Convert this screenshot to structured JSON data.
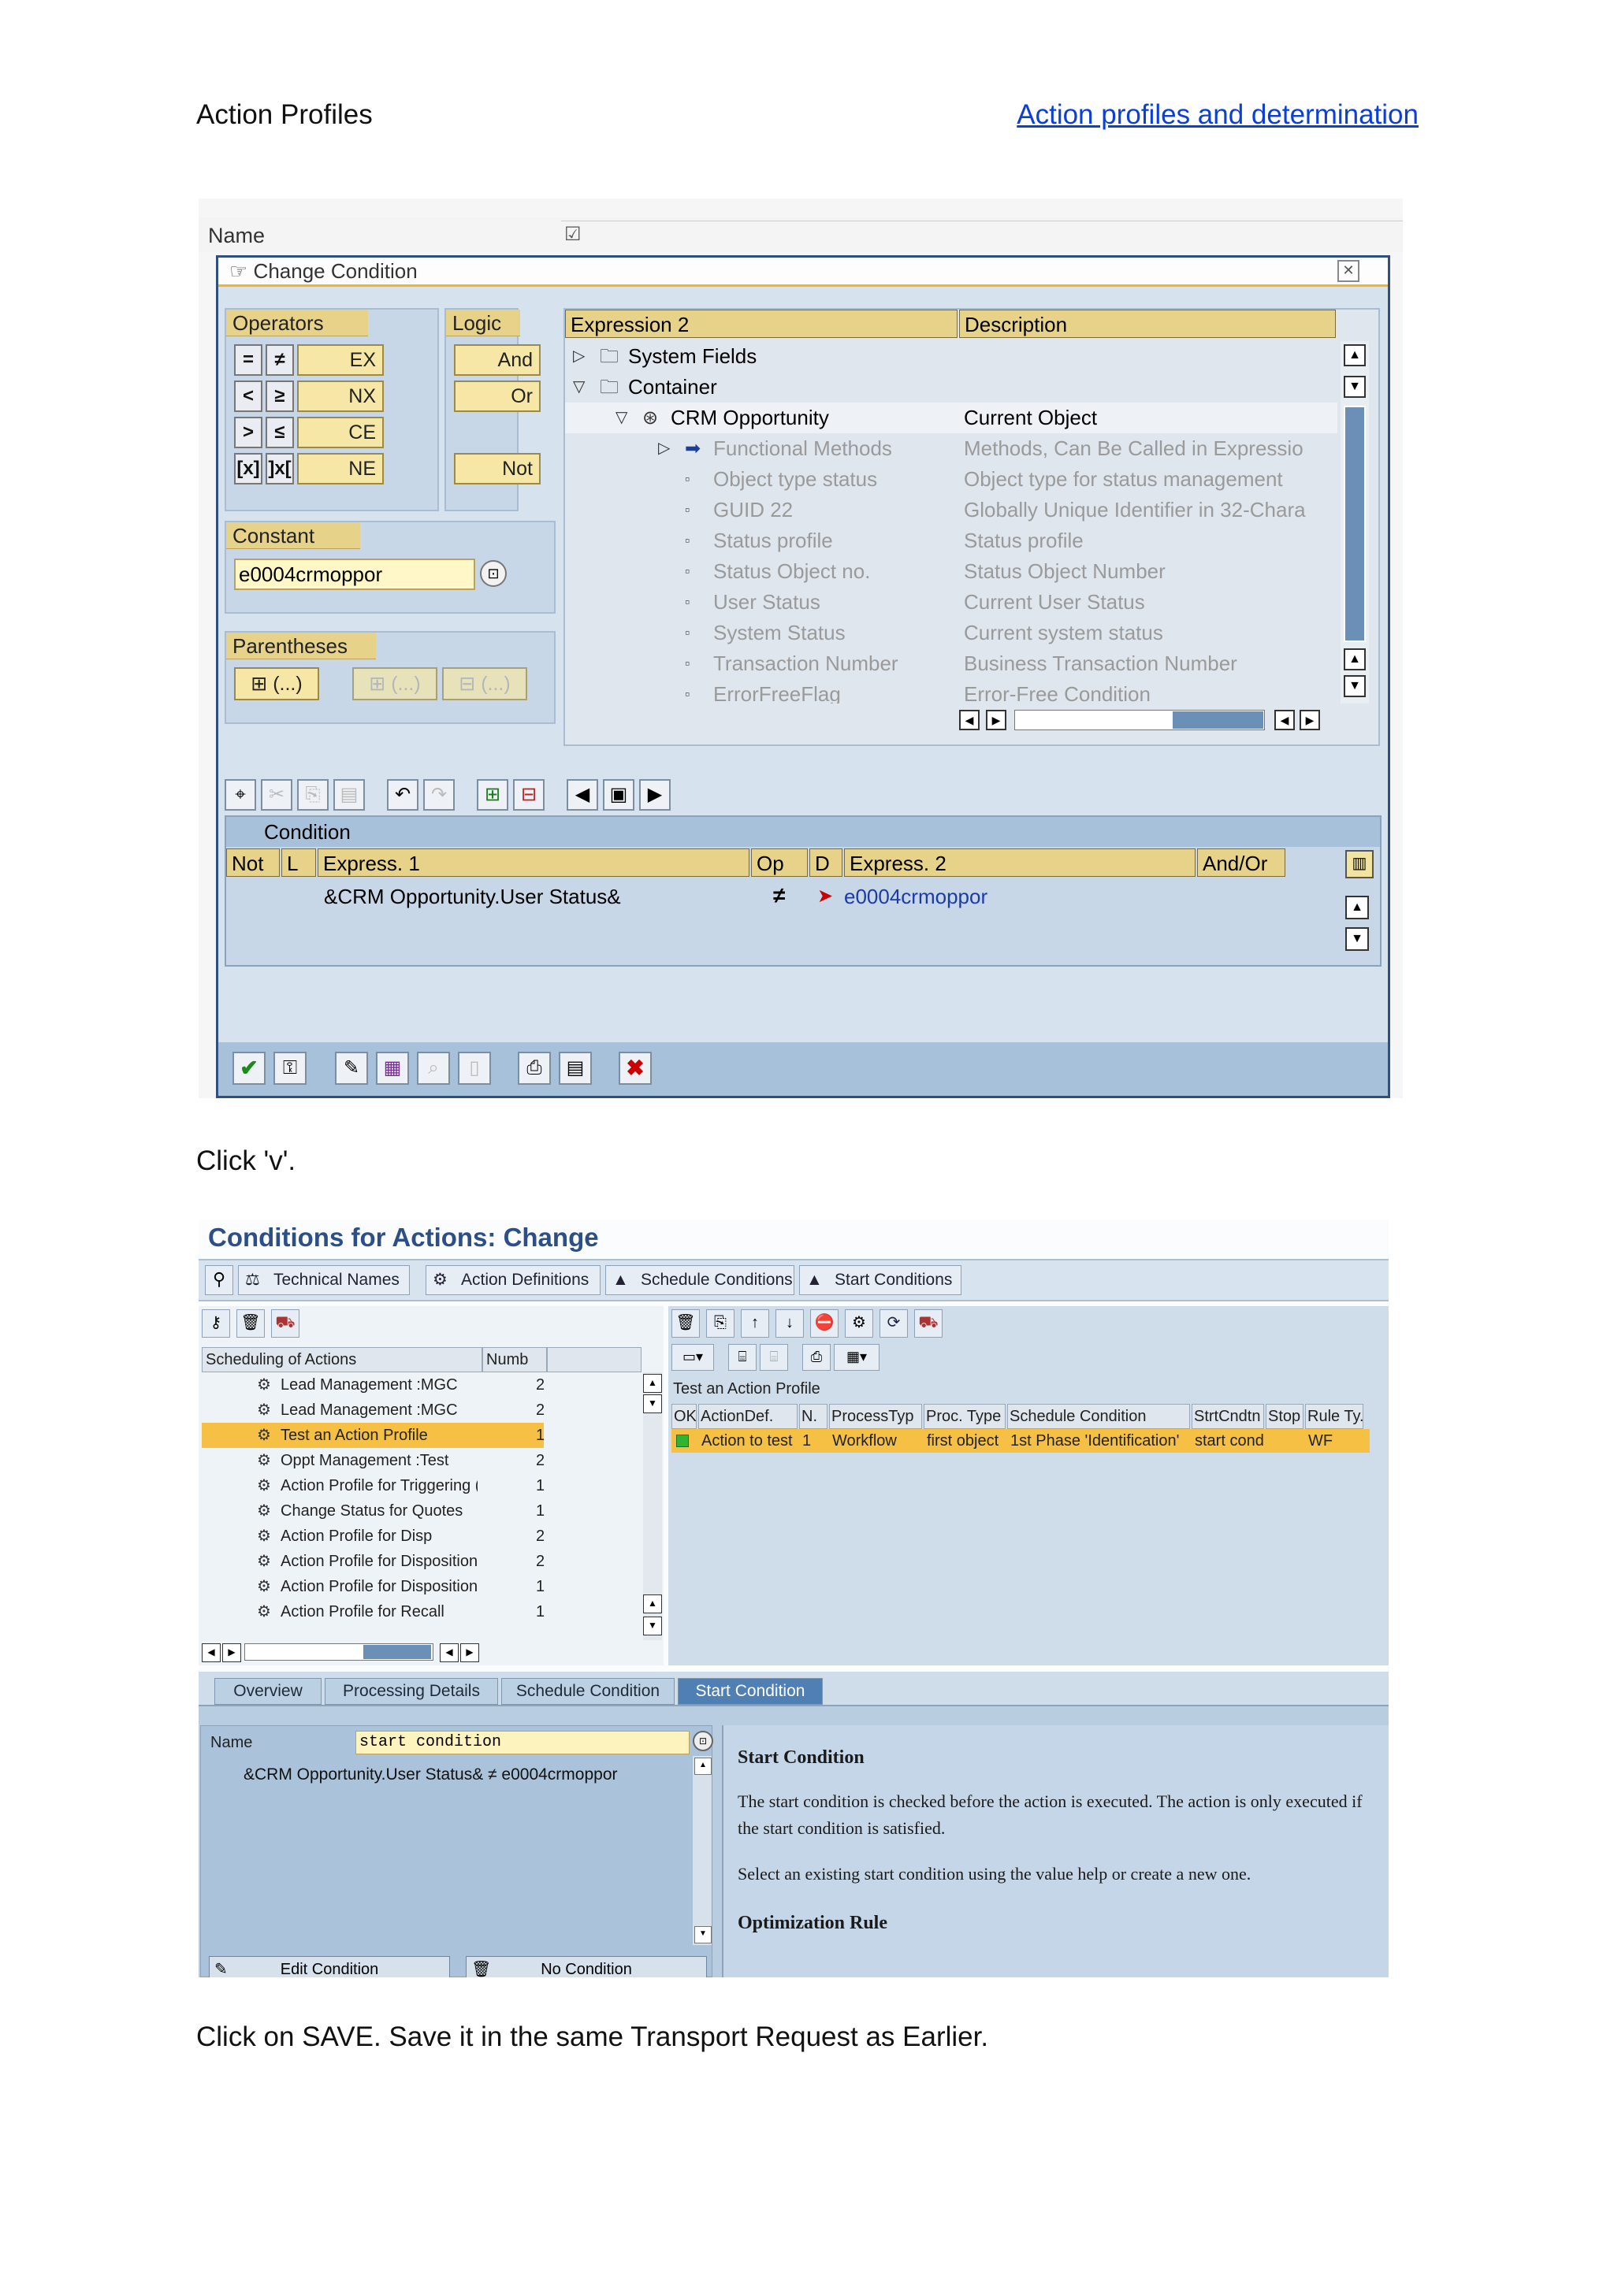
{
  "header": {
    "left_title": "Action Profiles",
    "right_link": "Action profiles and determination"
  },
  "shot1": {
    "name_label": "Name",
    "dialog_title": "Change Condition",
    "operators": {
      "title": "Operators",
      "rows": [
        {
          "a": "=",
          "b": "≠",
          "c": "EX"
        },
        {
          "a": "<",
          "b": "≥",
          "c": "NX"
        },
        {
          "a": ">",
          "b": "≤",
          "c": "CE"
        },
        {
          "a": "[x]",
          "b": "]x[",
          "c": "NE"
        }
      ]
    },
    "logic": {
      "title": "Logic",
      "and": "And",
      "or": "Or",
      "not": "Not"
    },
    "constant": {
      "title": "Constant",
      "value": "e0004crmoppor"
    },
    "parentheses": {
      "title": "Parentheses",
      "b1": "(...)",
      "b2": "(...)",
      "b3": "(...)"
    },
    "expr": {
      "col1": "Expression 2",
      "col2": "Description",
      "rows": [
        {
          "indent": 0,
          "marker": "▷",
          "icon": "folder",
          "label": "System Fields",
          "desc": "",
          "dim": false
        },
        {
          "indent": 0,
          "marker": "▽",
          "icon": "folder",
          "label": "Container",
          "desc": "",
          "dim": false
        },
        {
          "indent": 1,
          "marker": "▽",
          "icon": "object",
          "label": "CRM Opportunity",
          "desc": "Current Object",
          "dim": false
        },
        {
          "indent": 2,
          "marker": "▷",
          "icon": "arrow",
          "label": "Functional Methods",
          "desc": "Methods, Can Be Called in Expressio",
          "dim": true
        },
        {
          "indent": 2,
          "marker": "",
          "icon": "attr",
          "label": "Object type status",
          "desc": "Object type for status management",
          "dim": true
        },
        {
          "indent": 2,
          "marker": "",
          "icon": "attr",
          "label": "GUID 22",
          "desc": "Globally Unique Identifier in 32-Chara",
          "dim": true
        },
        {
          "indent": 2,
          "marker": "",
          "icon": "attr",
          "label": "Status profile",
          "desc": "Status profile",
          "dim": true
        },
        {
          "indent": 2,
          "marker": "",
          "icon": "attr",
          "label": "Status Object no.",
          "desc": "Status Object Number",
          "dim": true
        },
        {
          "indent": 2,
          "marker": "",
          "icon": "attr",
          "label": "User Status",
          "desc": "Current User Status",
          "dim": true
        },
        {
          "indent": 2,
          "marker": "",
          "icon": "attr",
          "label": "System Status",
          "desc": "Current system status",
          "dim": true
        },
        {
          "indent": 2,
          "marker": "",
          "icon": "attr",
          "label": "Transaction Number",
          "desc": "Business Transaction Number",
          "dim": true
        },
        {
          "indent": 2,
          "marker": "",
          "icon": "attr",
          "label": "ErrorFreeFlag",
          "desc": "Error-Free Condition",
          "dim": true
        }
      ]
    },
    "condition": {
      "title": "Condition",
      "cols": [
        "Not",
        "L",
        "Express. 1",
        "Op",
        "D",
        "Express. 2",
        "And/Or"
      ],
      "row": {
        "expr1": "&CRM Opportunity.User Status&",
        "op": "≠",
        "expr2": "e0004crmoppor"
      }
    }
  },
  "instruction1": "Click 'v'.",
  "shot2": {
    "title": "Conditions for Actions: Change",
    "toolbar": [
      "Technical Names",
      "Action Definitions",
      "Schedule Conditions",
      "Start Conditions"
    ],
    "left_table": {
      "col1": "Scheduling of Actions",
      "col2": "Numb",
      "rows": [
        {
          "label": "Lead Management :MGC",
          "num": "2",
          "selected": false
        },
        {
          "label": "Lead Management :MGC",
          "num": "2",
          "selected": false
        },
        {
          "label": "Test an Action Profile",
          "num": "1",
          "selected": true
        },
        {
          "label": "Oppt Management :Test",
          "num": "2",
          "selected": false
        },
        {
          "label": "Action Profile for Triggering (",
          "num": "1",
          "selected": false
        },
        {
          "label": "Change Status for Quotes",
          "num": "1",
          "selected": false
        },
        {
          "label": "Action Profile for Disp",
          "num": "2",
          "selected": false
        },
        {
          "label": "Action Profile for Disposition",
          "num": "2",
          "selected": false
        },
        {
          "label": "Action Profile for Disposition",
          "num": "1",
          "selected": false
        },
        {
          "label": "Action Profile for Recall",
          "num": "1",
          "selected": false
        }
      ]
    },
    "right_table": {
      "caption": "Test an Action Profile",
      "cols": [
        "OK",
        "ActionDef.",
        "N.",
        "ProcessTyp",
        "Proc. Type",
        "Schedule Condition",
        "StrtCndtn",
        "Stop",
        "Rule Ty."
      ],
      "row": [
        "",
        "Action to test",
        "1",
        "Workflow",
        "first object",
        "1st Phase 'Identification'",
        "start cond",
        "",
        "WF"
      ]
    },
    "tabs": [
      "Overview",
      "Processing Details",
      "Schedule Condition",
      "Start Condition"
    ],
    "name_label": "Name",
    "name_value": "start condition",
    "condition_text": "&CRM Opportunity.User Status& ≠ e0004crmoppor",
    "edit_button": "Edit Condition",
    "no_condition_button": "No Condition",
    "help": {
      "heading": "Start Condition",
      "p1": "The start condition is checked before the action is executed. The action is only executed if the start condition is satisfied.",
      "p2": "Select an existing start condition using the value help or create a new one.",
      "p3": "Optimization Rule"
    }
  },
  "instruction2": "Click on SAVE. Save it in the same Transport Request as Earlier.",
  "colors": {
    "sap_blue": "#2b4f86",
    "highlight": "#f5c043",
    "panel": "#c7d7e7"
  }
}
